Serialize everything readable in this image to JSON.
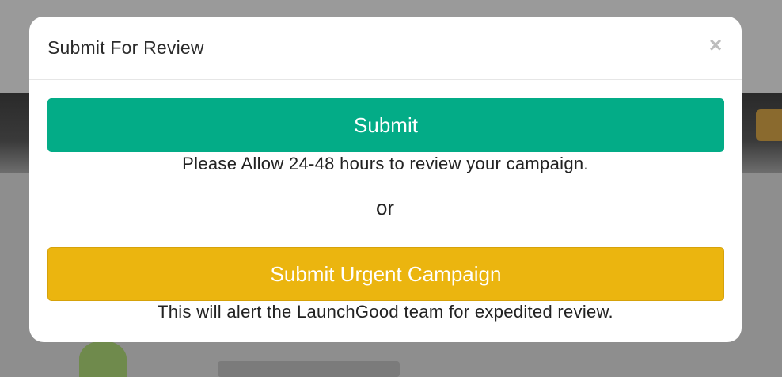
{
  "modal": {
    "title": "Submit For Review",
    "close_symbol": "×",
    "submit_button_label": "Submit",
    "submit_note": "Please Allow 24-48 hours to review your campaign.",
    "divider_text": "or",
    "urgent_button_label": "Submit Urgent Campaign",
    "urgent_note": "This will alert the LaunchGood team for expedited review."
  },
  "colors": {
    "submit_button": "#03ac87",
    "urgent_button": "#ebb50f",
    "overlay": "#8f8f8f"
  },
  "icons": {
    "close": "close-icon"
  }
}
